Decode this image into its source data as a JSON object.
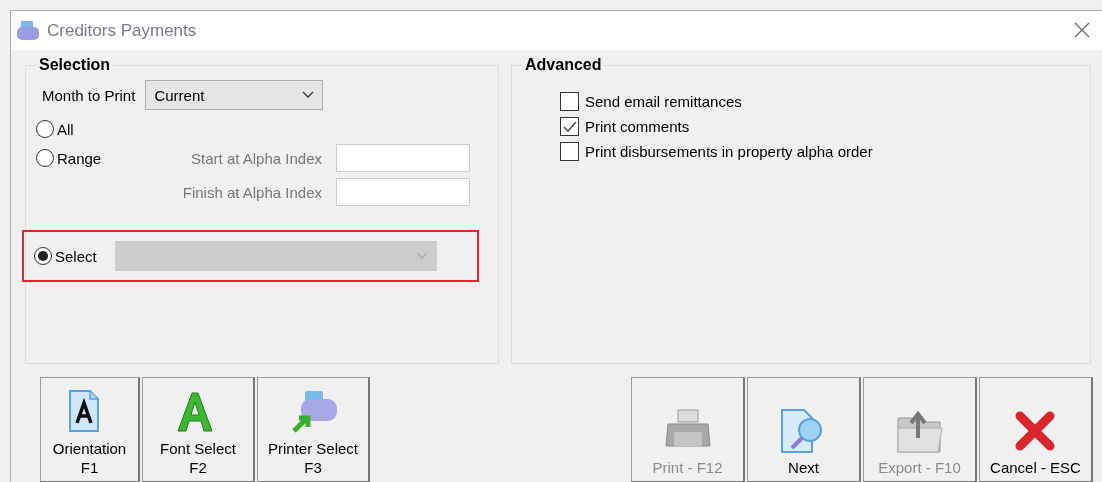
{
  "window": {
    "title": "Creditors Payments"
  },
  "selection": {
    "title": "Selection",
    "month_label": "Month to Print",
    "month_value": "Current",
    "options": [
      {
        "label": "All",
        "selected": false
      },
      {
        "label": "Range",
        "selected": false
      },
      {
        "label": "Select",
        "selected": true
      }
    ],
    "range_fields": [
      {
        "label": "Start at Alpha Index",
        "disabled": true
      },
      {
        "label": "Finish at Alpha Index",
        "disabled": true
      }
    ],
    "select_dropdown": {
      "disabled": true
    },
    "highlighted": true
  },
  "advanced": {
    "title": "Advanced",
    "options": [
      {
        "label": "Send email remittances",
        "checked": false
      },
      {
        "label": "Print comments",
        "checked": true
      },
      {
        "label": "Print disbursements in property alpha order",
        "checked": false
      }
    ]
  },
  "left_buttons": [
    {
      "kind": "page",
      "label": "Orientation",
      "key": "F1",
      "disabled": false
    },
    {
      "kind": "font",
      "label": "Font Select",
      "key": "F2",
      "disabled": false
    },
    {
      "kind": "printer-arrow",
      "label": "Printer Select",
      "key": "F3",
      "disabled": false
    }
  ],
  "right_buttons": [
    {
      "kind": "printer",
      "label": "Print - F12",
      "disabled": true
    },
    {
      "kind": "preview",
      "label": "Next",
      "disabled": false
    },
    {
      "kind": "folder",
      "label": "Export - F10",
      "disabled": true
    },
    {
      "kind": "cross",
      "label": "Cancel - ESC",
      "disabled": false
    }
  ]
}
